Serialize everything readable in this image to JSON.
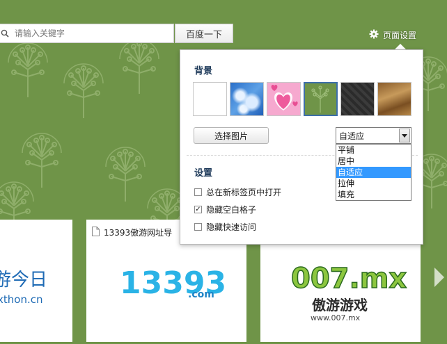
{
  "search": {
    "placeholder": "请输入关键字",
    "button_label": "百度一下"
  },
  "header": {
    "page_settings_label": "页面设置"
  },
  "panel": {
    "background_title": "背景",
    "backgrounds": [
      {
        "name": "white",
        "selected": false
      },
      {
        "name": "blue-sky",
        "selected": false
      },
      {
        "name": "pink-hearts",
        "selected": false
      },
      {
        "name": "green-trees",
        "selected": true
      },
      {
        "name": "dark-pattern",
        "selected": false
      },
      {
        "name": "brown-wood",
        "selected": false
      }
    ],
    "choose_image_label": "选择图片",
    "fit_select": {
      "value": "自适应",
      "options": [
        "平铺",
        "居中",
        "自适应",
        "拉伸",
        "填充"
      ]
    },
    "settings_title": "设置",
    "checkboxes": [
      {
        "label": "总在新标签页中打开",
        "checked": false
      },
      {
        "label": "隐藏空白格子",
        "checked": true
      },
      {
        "label": "隐藏快速访问",
        "checked": false
      }
    ]
  },
  "tiles": [
    {
      "title": "",
      "logo_text": "游今日",
      "logo_sub": "xthon.cn"
    },
    {
      "title": "13393傲游网址导",
      "logo_text": "13393",
      "logo_sub": ".com"
    },
    {
      "title": "",
      "logo_text": "007.mx",
      "logo_sub": "傲游游戏",
      "logo_url": "www.007.mx"
    }
  ],
  "colors": {
    "background_green": "#6f9448",
    "selected_border": "#3d6fa8",
    "dropdown_highlight": "#3399ff",
    "title_blue": "#1e3a5a"
  }
}
